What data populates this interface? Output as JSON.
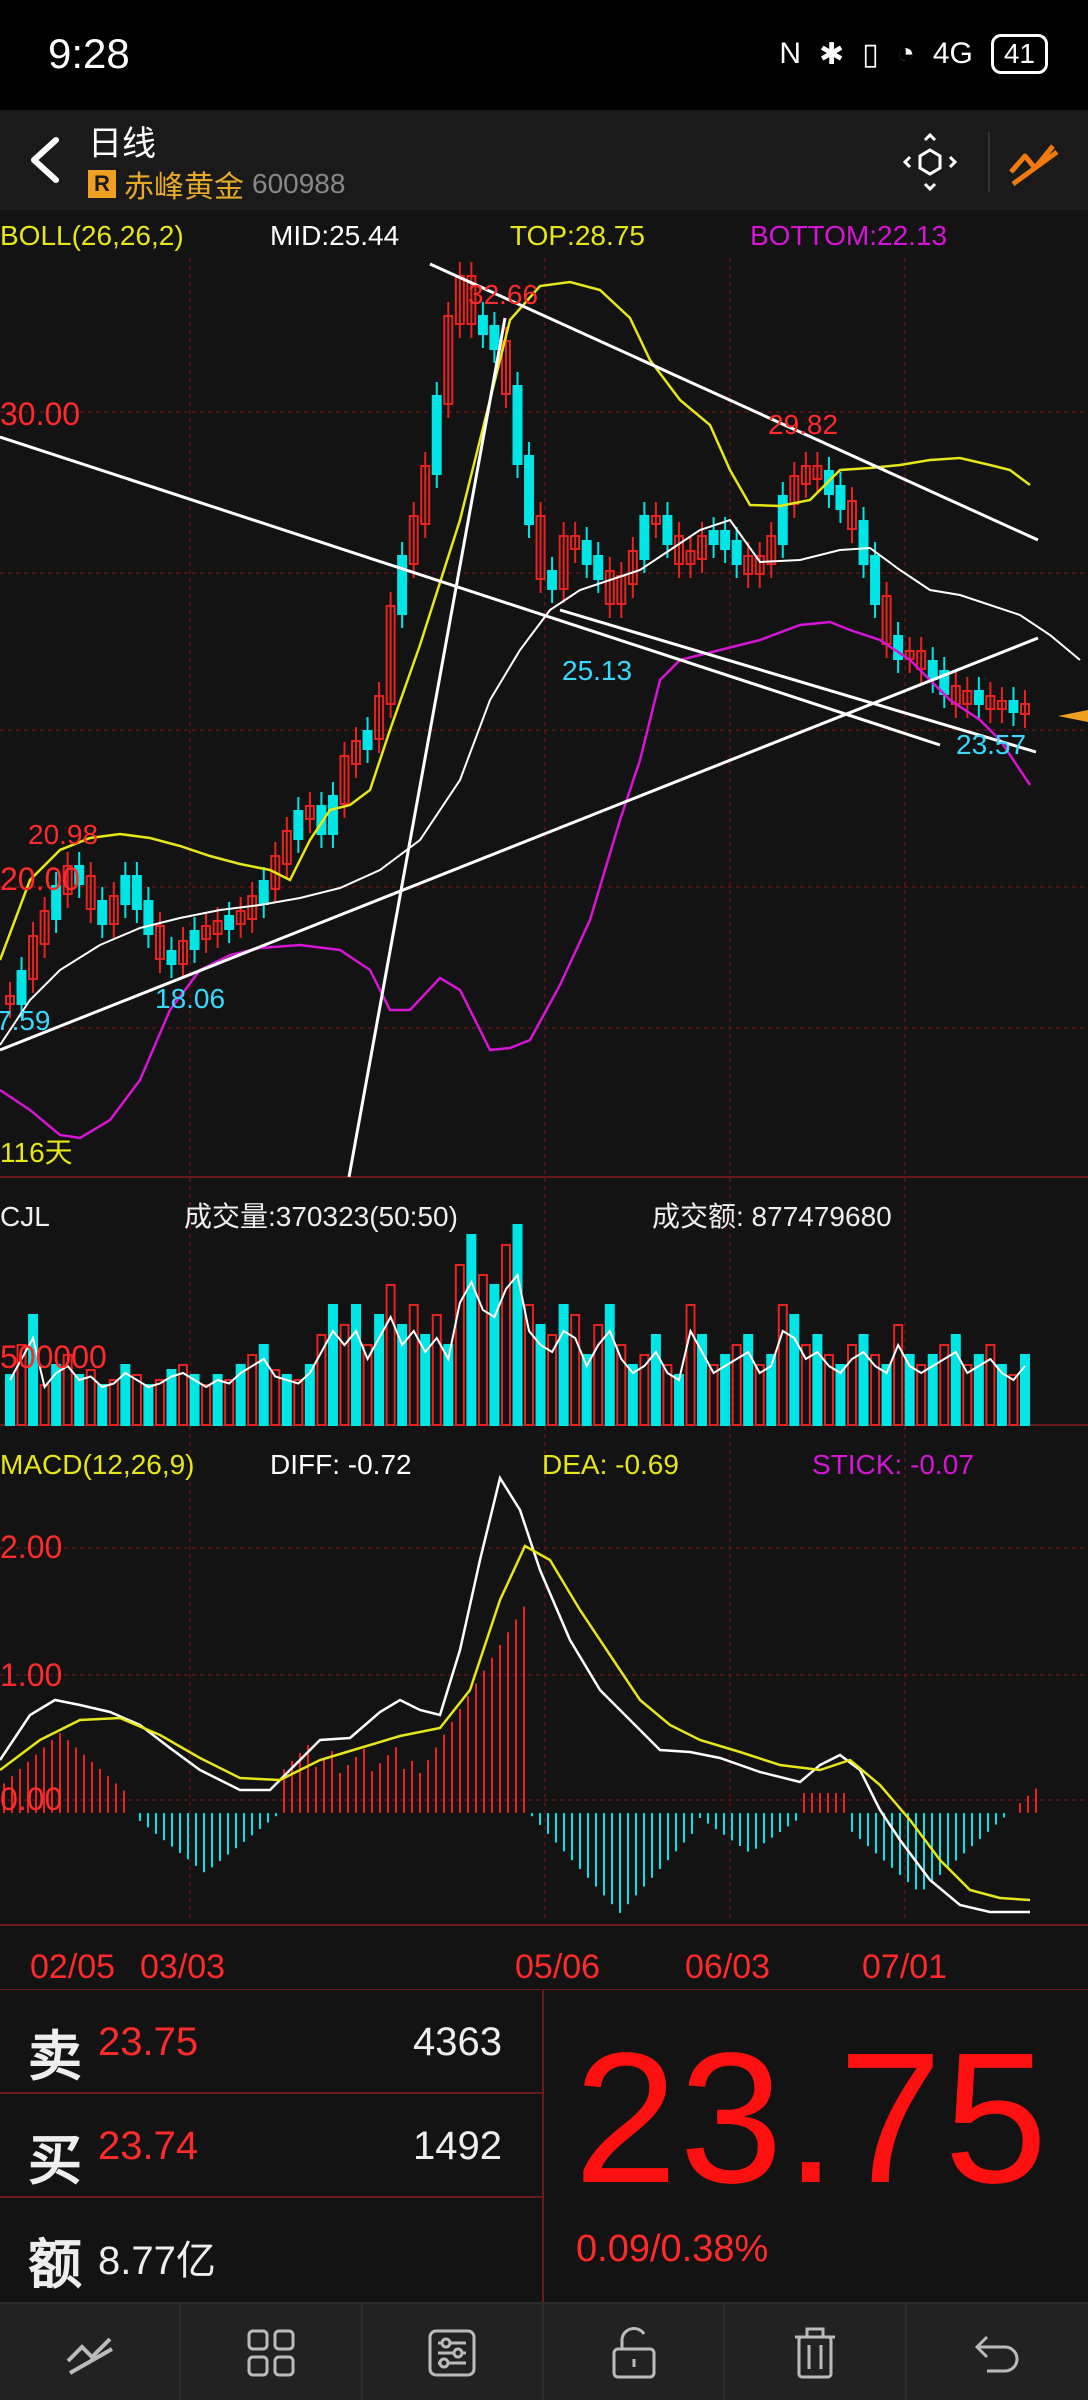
{
  "status_bar": {
    "time": "9:28",
    "network": "4G",
    "battery": "41"
  },
  "header": {
    "title": "日线",
    "badge": "R",
    "stock_name": "赤峰黄金",
    "stock_code": "600988"
  },
  "indicators": {
    "boll": {
      "label": "BOLL(26,26,2)",
      "mid": "MID:25.44",
      "top": "TOP:28.75",
      "bottom": "BOTTOM:22.13"
    },
    "volume": {
      "label": "CJL",
      "volume": "成交量:370323(50:50)",
      "amount": "成交额: 877479680"
    },
    "macd": {
      "label": "MACD(12,26,9)",
      "diff": "DIFF: -0.72",
      "dea": "DEA: -0.69",
      "stick": "STICK: -0.07"
    }
  },
  "chart_data": [
    {
      "type": "candlestick",
      "price_axis_labels": [
        "30.00",
        "20.00"
      ],
      "annotations": [
        "32.66",
        "29.82",
        "25.13",
        "23.57",
        "20.98",
        "18.06",
        "7.59",
        "116天"
      ],
      "date_labels": [
        "02/05",
        "03/03",
        "05/06",
        "06/03",
        "07/01"
      ],
      "last_close": 23.75,
      "colors": {
        "up": "#e8231f",
        "down": "#00e5e5",
        "mid": "#ffffff",
        "upper": "#e6e619",
        "lower": "#d615d6",
        "trend": "#ffffff"
      }
    },
    {
      "type": "bar",
      "name": "volume",
      "axis_label": "500000"
    },
    {
      "type": "bar",
      "name": "macd",
      "axis_labels": [
        "2.00",
        "1.00",
        "0.00"
      ],
      "values": {
        "diff": -0.72,
        "dea": -0.69,
        "stick": -0.07
      }
    }
  ],
  "order_book": {
    "sell": {
      "label": "卖",
      "price": "23.75",
      "volume": "4363"
    },
    "buy": {
      "label": "买",
      "price": "23.74",
      "volume": "1492"
    },
    "amount": {
      "label": "额",
      "value": "8.77亿"
    },
    "last_price": "23.75",
    "change": "0.09/0.38%"
  },
  "toolbar": [
    "chart-style-icon",
    "grid-icon",
    "settings-icon",
    "unlock-icon",
    "trash-icon",
    "return-icon"
  ]
}
